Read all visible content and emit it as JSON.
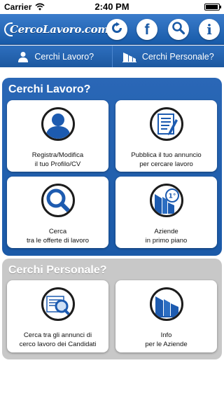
{
  "status_bar": {
    "carrier": "Carrier",
    "time": "2:40 PM"
  },
  "header": {
    "logo_text": "CercoLavoro.com",
    "icons": [
      "refresh-icon",
      "facebook-icon",
      "search-icon",
      "info-icon"
    ]
  },
  "tabs": [
    {
      "label": "Cerchi Lavoro?",
      "icon": "person-icon"
    },
    {
      "label": "Cerchi Personale?",
      "icon": "buildings-icon"
    }
  ],
  "groups": {
    "lavoro": {
      "title": "Cerchi Lavoro?",
      "cards": [
        {
          "label": "Registra/Modifica\nil tuo Profilo/CV",
          "icon": "profile-icon"
        },
        {
          "label": "Pubblica il tuo annuncio\nper cercare lavoro",
          "icon": "document-pencil-icon"
        },
        {
          "label": "Cerca\ntra le offerte di lavoro",
          "icon": "magnifier-icon"
        },
        {
          "label": "Aziende\nin primo piano",
          "icon": "company-badge-icon"
        }
      ]
    },
    "personale": {
      "title": "Cerchi Personale?",
      "cards": [
        {
          "label": "Cerca tra gli annunci di\ncerco lavoro dei Candidati",
          "icon": "search-resumes-icon"
        },
        {
          "label": "Info\nper le Aziende",
          "icon": "buildings-info-icon"
        }
      ]
    }
  },
  "colors": {
    "primary": "#1b5aa8",
    "header_top": "#3b7ccb",
    "gray_panel": "#c8c8c8"
  }
}
